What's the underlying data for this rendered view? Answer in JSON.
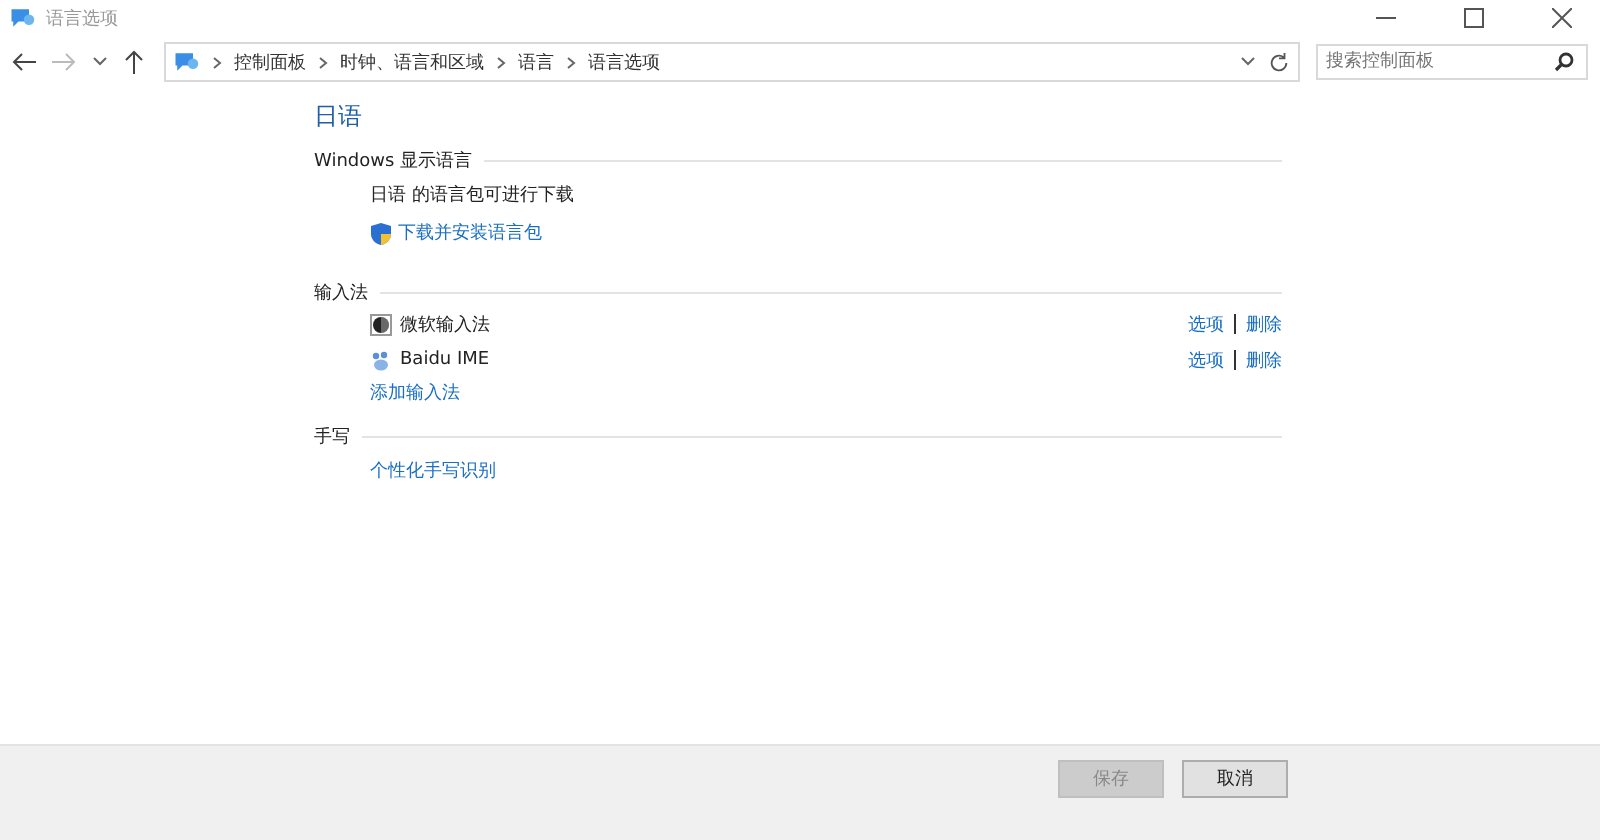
{
  "window": {
    "title": "语言选项"
  },
  "address_bar": {
    "breadcrumbs": [
      "控制面板",
      "时钟、语言和区域",
      "语言",
      "语言选项"
    ]
  },
  "search": {
    "placeholder": "搜索控制面板"
  },
  "language": {
    "title": "日语"
  },
  "display_language": {
    "heading": "Windows 显示语言",
    "status": "日语 的语言包可进行下载",
    "link": "下载并安装语言包"
  },
  "input_methods": {
    "heading": "输入法",
    "items": [
      {
        "name": "微软输入法",
        "kind": "microsoft",
        "options": "选项",
        "remove": "删除"
      },
      {
        "name": "Baidu IME",
        "kind": "baidu",
        "options": "选项",
        "remove": "删除"
      }
    ],
    "add_link": "添加输入法"
  },
  "handwriting": {
    "heading": "手写",
    "link": "个性化手写识别"
  },
  "buttons": [
    {
      "label": "保存",
      "disabled": true
    },
    {
      "label": "取消",
      "disabled": false
    }
  ]
}
